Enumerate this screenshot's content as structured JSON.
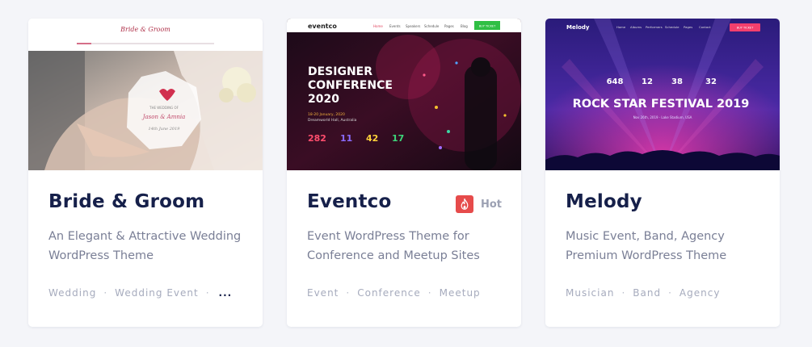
{
  "colors": {
    "page_bg": "#f4f5f9",
    "card_bg": "#ffffff",
    "title": "#16204a",
    "desc": "#7a7f96",
    "tag": "#a6abbd",
    "hot_badge": "#e64b4b"
  },
  "cards": [
    {
      "title": "Bride & Groom",
      "description": "An Elegant & Attractive Wedding WordPress Theme",
      "tags": [
        "Wedding",
        "Wedding Event"
      ],
      "more": "...",
      "thumbnail": {
        "logo": "Bride & Groom",
        "badge_line1": "THE WEDDING OF",
        "badge_names": "Jason & Amnia",
        "badge_date": "14th June 2019"
      }
    },
    {
      "title": "Eventco",
      "description": "Event WordPress Theme for Conference and Meetup Sites",
      "tags": [
        "Event",
        "Conference",
        "Meetup"
      ],
      "hot_label": "Hot",
      "thumbnail": {
        "logo": "eventco",
        "nav": [
          "Home",
          "Events",
          "Speakers",
          "Schedule",
          "Pages",
          "Blog"
        ],
        "cta": "BUY TICKET",
        "headline1": "DESIGNER",
        "headline2": "CONFERENCE",
        "headline3": "2020",
        "date_line": "18-20 January, 2020",
        "venue_line": "Dreamworld Hall, Australia",
        "countdown": [
          "282",
          "11",
          "42",
          "17"
        ]
      }
    },
    {
      "title": "Melody",
      "description": "Music Event, Band, Agency Premium WordPress Theme",
      "tags": [
        "Musician",
        "Band",
        "Agency"
      ],
      "thumbnail": {
        "logo": "Melody",
        "nav": [
          "Home",
          "Albums",
          "Performers",
          "Schedule",
          "Pages",
          "Contact"
        ],
        "cta": "BUY TICKET",
        "countdown": [
          "648",
          "12",
          "38",
          "32"
        ],
        "headline": "ROCK STAR FESTIVAL 2019",
        "sub": "Nov 26th, 2019  ·  Lake Stadium, USA"
      }
    }
  ]
}
